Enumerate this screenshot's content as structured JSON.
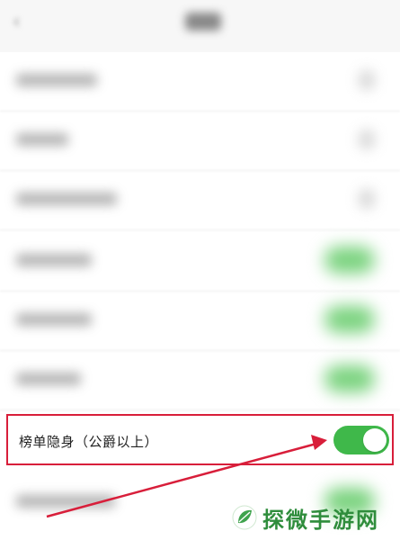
{
  "highlighted_row": {
    "label": "榜单隐身（公爵以上）",
    "toggle_on": true
  },
  "watermark": {
    "text": "探微手游网"
  },
  "colors": {
    "toggle_on": "#3fb84a",
    "highlight_border": "#d81e3a",
    "arrow": "#d81e3a",
    "watermark": "#2f8d3c"
  },
  "icons": {
    "back": "back-arrow-icon",
    "chevron": "chevron-right-icon",
    "watermark_logo": "leaf-logo-icon"
  }
}
